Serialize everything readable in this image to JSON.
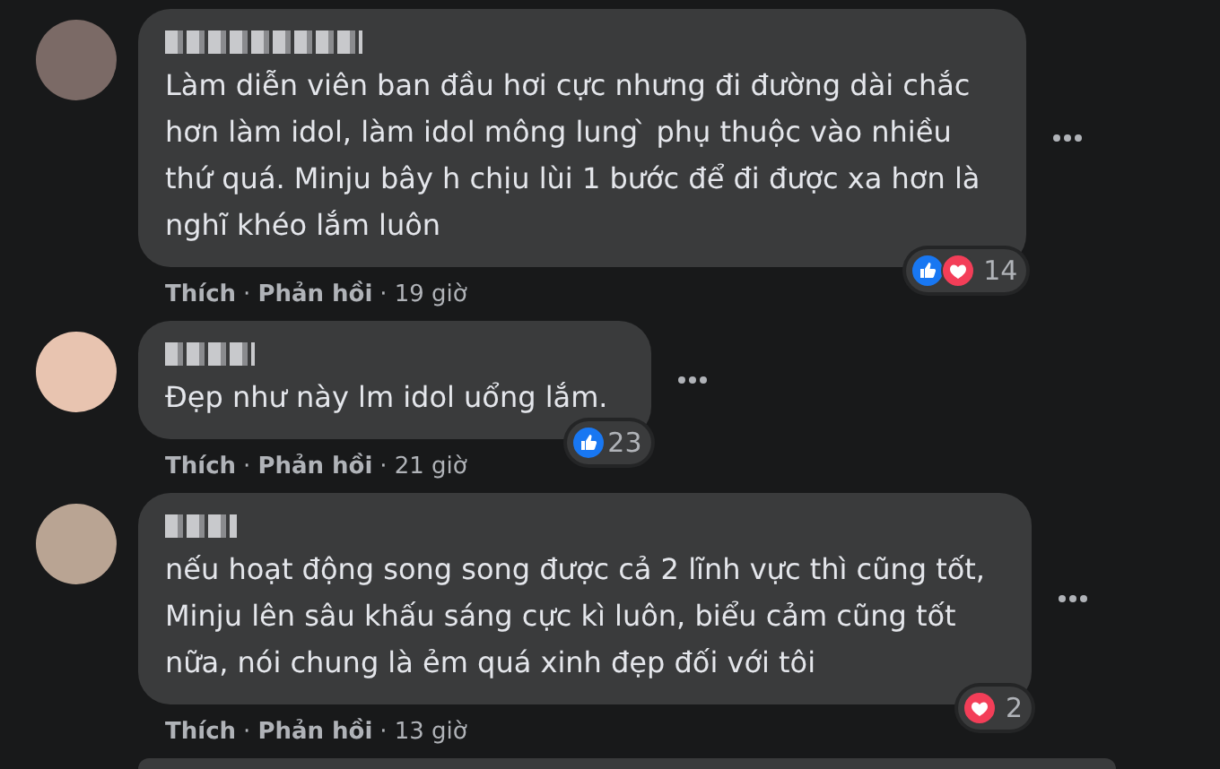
{
  "comments": [
    {
      "lines": [
        "Làm diễn viên ban đầu hơi cực nhưng đi đường dài chắc",
        "hơn làm idol, làm idol mông lung  ̀  phụ thuộc vào nhiều",
        "thứ quá. Minju bây h chịu lùi 1 bước để đi được xa hơn là",
        "nghĩ khéo lắm luôn"
      ],
      "reactions": [
        {
          "kind": "like"
        },
        {
          "kind": "love"
        }
      ],
      "reaction_count": "14",
      "actions": [
        "Thích",
        "Phản hồi"
      ],
      "separator": "·",
      "time": "19 giờ"
    },
    {
      "lines": [
        "Đẹp như này lm idol uổng lắm."
      ],
      "reactions": [
        {
          "kind": "like"
        }
      ],
      "reaction_count": "23",
      "actions": [
        "Thích",
        "Phản hồi"
      ],
      "separator": "·",
      "time": "21 giờ"
    },
    {
      "lines": [
        "nếu hoạt động song song được cả 2 lĩnh vực thì cũng tốt,",
        "Minju lên sâu khấu sáng cực kì luôn, biểu cảm cũng tốt",
        "nữa, nói chung là ẻm quá xinh đẹp đối với tôi"
      ],
      "reactions": [
        {
          "kind": "love"
        }
      ],
      "reaction_count": "2",
      "actions": [
        "Thích",
        "Phản hồi"
      ],
      "separator": "·",
      "time": "13 giờ"
    }
  ]
}
